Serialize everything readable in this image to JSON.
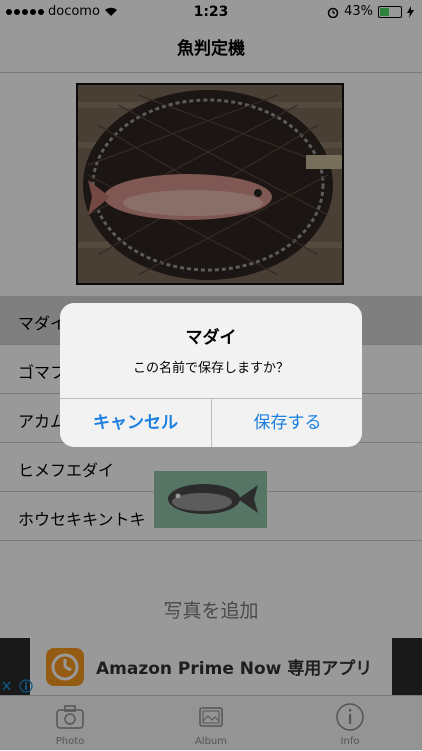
{
  "status_bar": {
    "carrier": "docomo",
    "time": "1:23",
    "battery": "43%",
    "battery_level": 0.43
  },
  "nav": {
    "title": "魚判定機"
  },
  "list": {
    "items": [
      "マダイ",
      "ゴマフ",
      "アカム",
      "ヒメフエダイ",
      "ホウセキキントキ"
    ],
    "selected_index": 0
  },
  "add_photo": "写真を追加",
  "ad": {
    "text": "Amazon Prime Now",
    "suffix": "専用アプリ"
  },
  "tabs": [
    {
      "label": "Photo",
      "icon": "camera-icon"
    },
    {
      "label": "Album",
      "icon": "album-icon"
    },
    {
      "label": "Info",
      "icon": "info-icon"
    }
  ],
  "alert": {
    "title": "マダイ",
    "message": "この名前で保存しますか？",
    "cancel": "キャンセル",
    "save": "保存する"
  },
  "colors": {
    "accent": "#1a7fe0",
    "ad_icon": "#f79a1e",
    "battery": "#4cd964"
  }
}
